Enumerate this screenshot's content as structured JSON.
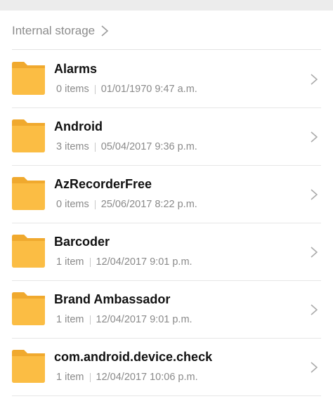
{
  "breadcrumb": {
    "label": "Internal storage"
  },
  "colors": {
    "folder": "#fbbd44",
    "folder_tab": "#f0a92e",
    "chevron": "#a8a8a8"
  },
  "files": [
    {
      "name": "Alarms",
      "count": "0 items",
      "date": "01/01/1970 9:47 a.m."
    },
    {
      "name": "Android",
      "count": "3 items",
      "date": "05/04/2017 9:36 p.m."
    },
    {
      "name": "AzRecorderFree",
      "count": "0 items",
      "date": "25/06/2017 8:22 p.m."
    },
    {
      "name": "Barcoder",
      "count": "1 item",
      "date": "12/04/2017 9:01 p.m."
    },
    {
      "name": "Brand Ambassador",
      "count": "1 item",
      "date": "12/04/2017 9:01 p.m."
    },
    {
      "name": "com.android.device.check",
      "count": "1 item",
      "date": "12/04/2017 10:06 p.m."
    }
  ]
}
